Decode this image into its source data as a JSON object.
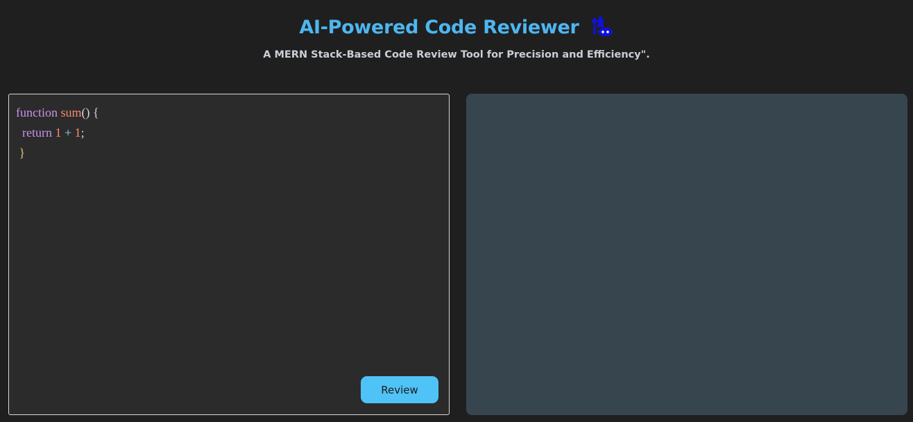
{
  "header": {
    "title": "AI-Powered Code Reviewer",
    "title_icon": "robot-code-icon",
    "subtitle": "A MERN Stack-Based Code Review Tool for Precision and Efficiency\"."
  },
  "editor": {
    "lines": [
      {
        "kw": "function",
        "fn": "sum",
        "rest": "() {"
      },
      {
        "kw": "return",
        "n1": "1",
        "op": "+",
        "n2": "1",
        "end": ";"
      },
      {
        "close": "}"
      }
    ]
  },
  "actions": {
    "review_label": "Review"
  },
  "colors": {
    "accent": "#4fc3f7",
    "title": "#4db6f0",
    "background": "#1f1f1f",
    "editor_bg": "#2b2b2b",
    "review_panel_bg": "#37454f"
  }
}
